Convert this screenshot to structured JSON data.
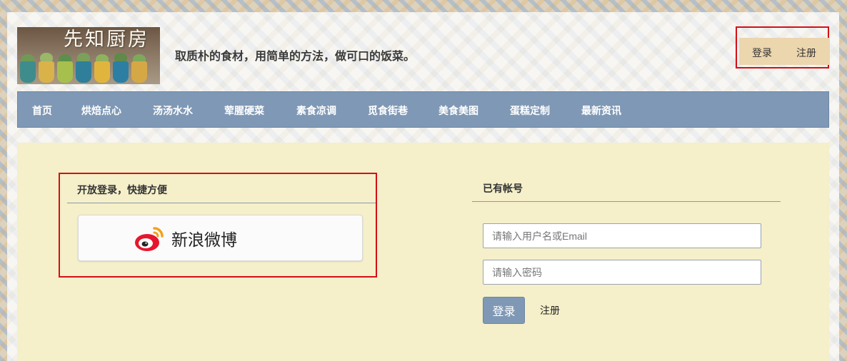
{
  "header": {
    "logo_text": "先知厨房",
    "tagline": "取质朴的食材，用简单的方法，做可口的饭菜。",
    "login_link": "登录",
    "register_link": "注册"
  },
  "nav": {
    "items": [
      "首页",
      "烘焙点心",
      "汤汤水水",
      "荤腥硬菜",
      "素食凉调",
      "觅食街巷",
      "美食美图",
      "蛋糕定制",
      "最新资讯"
    ]
  },
  "open_login": {
    "title": "开放登录，快捷方便",
    "weibo_label": "新浪微博",
    "weibo_icon": "weibo-icon"
  },
  "account_login": {
    "title": "已有帐号",
    "username_placeholder": "请输入用户名或Email",
    "password_placeholder": "请输入密码",
    "login_button": "登录",
    "register_link": "注册"
  },
  "colors": {
    "accent_red": "#d40f16",
    "nav_blue": "#7f98b5",
    "content_bg": "#f5efca",
    "auth_bg": "#ecd6ae"
  }
}
